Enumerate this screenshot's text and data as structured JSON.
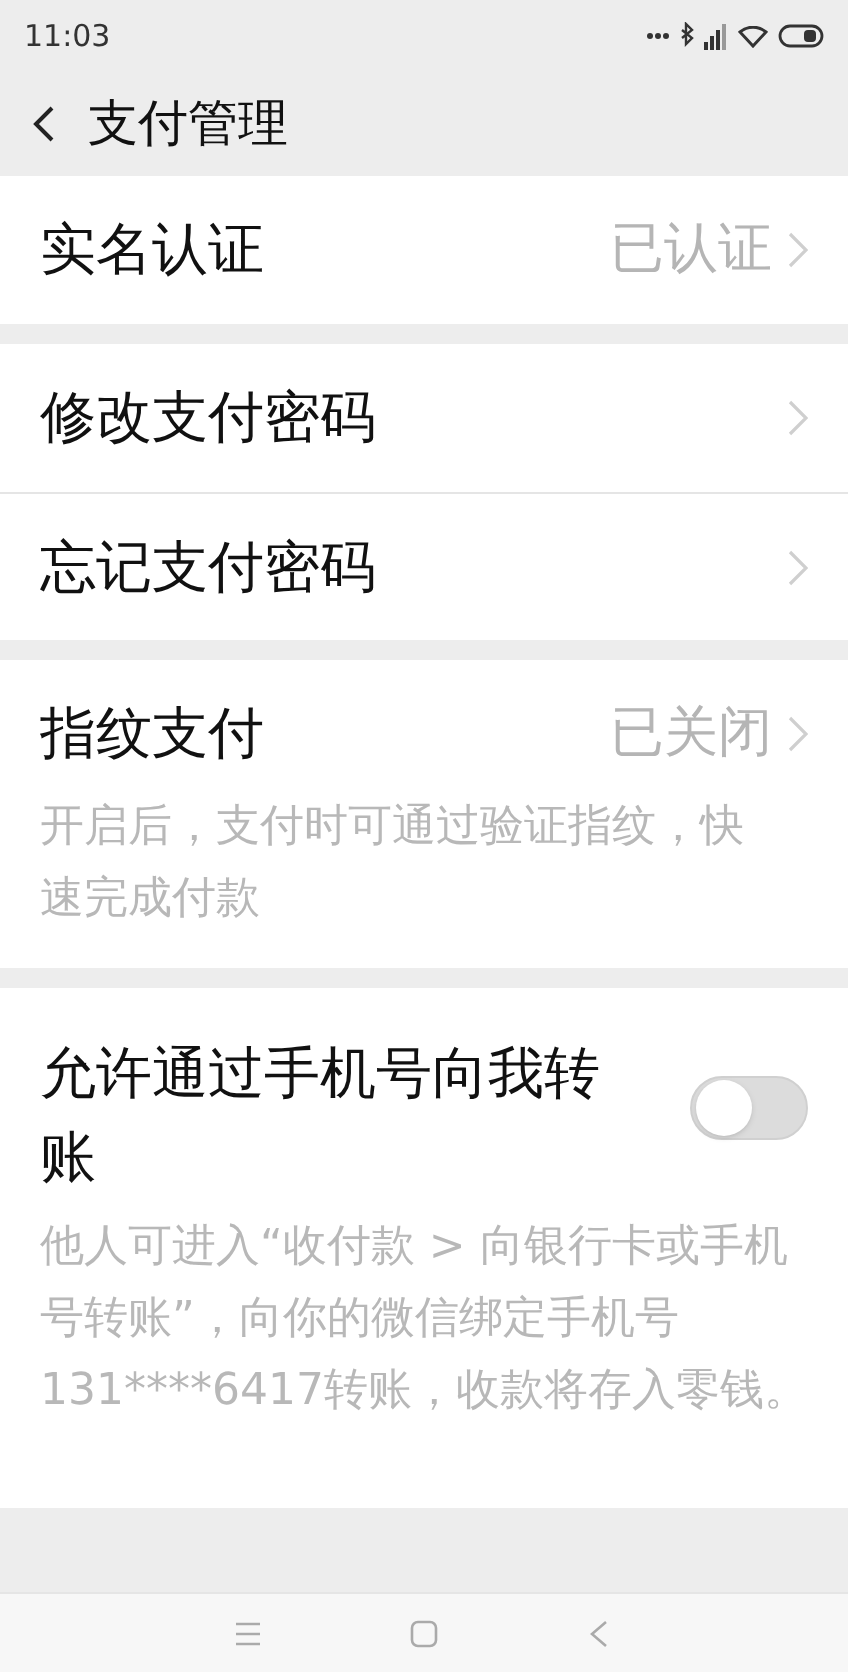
{
  "status_bar": {
    "time": "11:03"
  },
  "header": {
    "title": "支付管理"
  },
  "sections": [
    {
      "rows": [
        {
          "label": "实名认证",
          "value": "已认证"
        }
      ]
    },
    {
      "rows": [
        {
          "label": "修改支付密码"
        },
        {
          "label": "忘记支付密码"
        }
      ]
    },
    {
      "rows": [
        {
          "label": "指纹支付",
          "value": "已关闭"
        }
      ],
      "description": "开启后，支付时可通过验证指纹，快速完成付款"
    },
    {
      "toggle": {
        "label": "允许通过手机号向我转账",
        "on": false
      },
      "description": "他人可进入“收付款 > 向银行卡或手机号转账”，向你的微信绑定手机号131****6417转账，收款将存入零钱。"
    }
  ]
}
